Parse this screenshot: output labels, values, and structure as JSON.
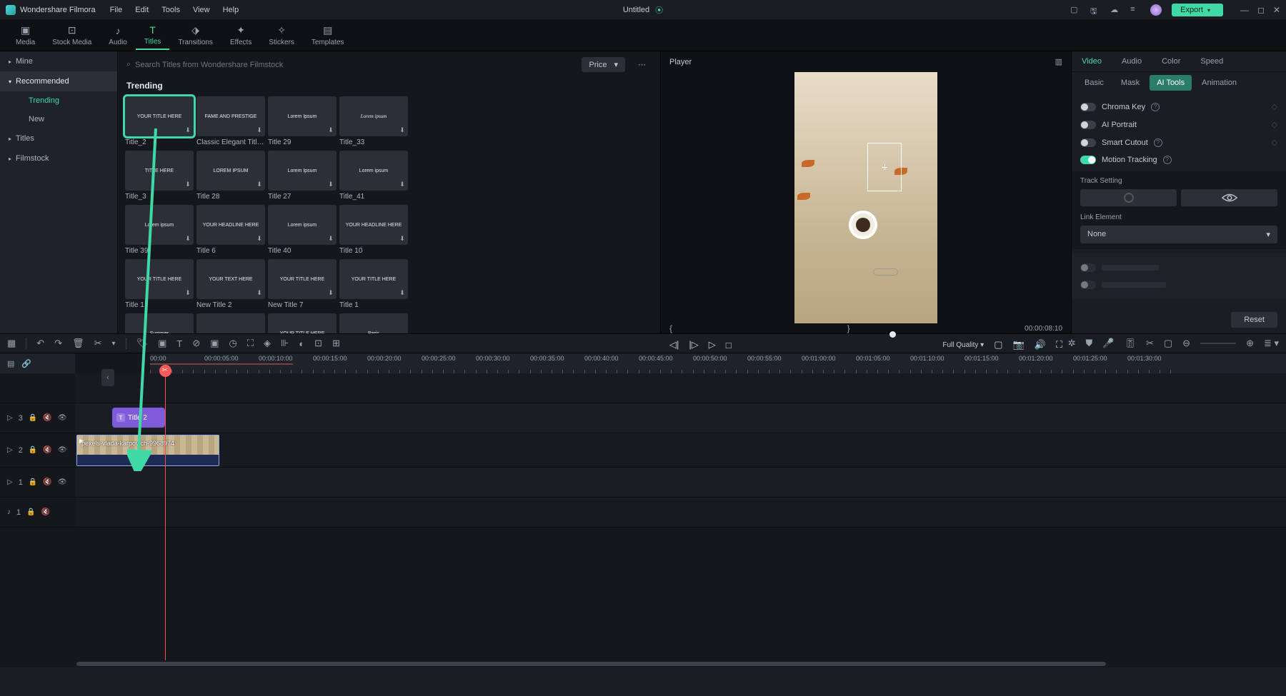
{
  "app": {
    "name": "Wondershare Filmora",
    "doc": "Untitled",
    "export": "Export"
  },
  "menus": [
    "File",
    "Edit",
    "Tools",
    "View",
    "Help"
  ],
  "tabs": [
    {
      "id": "media",
      "label": "Media"
    },
    {
      "id": "stock",
      "label": "Stock Media"
    },
    {
      "id": "audio",
      "label": "Audio"
    },
    {
      "id": "titles",
      "label": "Titles",
      "active": true
    },
    {
      "id": "transitions",
      "label": "Transitions"
    },
    {
      "id": "effects",
      "label": "Effects"
    },
    {
      "id": "stickers",
      "label": "Stickers"
    },
    {
      "id": "templates",
      "label": "Templates"
    }
  ],
  "tree": {
    "mine": "Mine",
    "recommended": "Recommended",
    "trending": "Trending",
    "new": "New",
    "titles": "Titles",
    "filmstock": "Filmstock"
  },
  "grid": {
    "search_ph": "Search Titles from Wondershare Filmstock",
    "sort": "Price",
    "section": "Trending",
    "cards": [
      {
        "label": "Title_2",
        "text": "YOUR TITLE HERE",
        "hl": true
      },
      {
        "label": "Classic Elegant Title P...",
        "text": "FAME AND PRESTIGE"
      },
      {
        "label": "Title 29",
        "text": "Lorem Ipsum"
      },
      {
        "label": "Title_33",
        "text": "Lorem ipsum",
        "italic": true
      },
      {
        "label": "Title_3",
        "text": "TITLE HERE"
      },
      {
        "label": "Title 28",
        "text": "LOREM IPSUM"
      },
      {
        "label": "Title 27",
        "text": "Lorem Ipsum"
      },
      {
        "label": "Title_41",
        "text": "Lorem ipsum"
      },
      {
        "label": "Title 39",
        "text": "Lorem ipsum"
      },
      {
        "label": "Title 6",
        "text": "YOUR HEADLINE HERE"
      },
      {
        "label": "Title 40",
        "text": "Lorem ipsum"
      },
      {
        "label": "Title 10",
        "text": "YOUR HEADLINE HERE"
      },
      {
        "label": "Title 1",
        "text": "YOUR TITLE HERE"
      },
      {
        "label": "New Title 2",
        "text": "YOUR TEXT HERE"
      },
      {
        "label": "New Title 7",
        "text": "YOUR TITLE HERE"
      },
      {
        "label": "Title 1",
        "text": "YOUR TITLE HERE"
      },
      {
        "label": "",
        "text": "Summer"
      },
      {
        "label": "",
        "text": ""
      },
      {
        "label": "",
        "text": "YOUR TITLE HERE"
      },
      {
        "label": "",
        "text": "Paris"
      }
    ]
  },
  "player": {
    "title": "Player",
    "tc": "00:00:08:10",
    "quality": "Full Quality"
  },
  "inspector": {
    "tabs": [
      "Video",
      "Audio",
      "Color",
      "Speed"
    ],
    "subtabs": [
      "Basic",
      "Mask",
      "AI Tools",
      "Animation"
    ],
    "props": {
      "chroma": "Chroma Key",
      "portrait": "AI Portrait",
      "cutout": "Smart Cutout",
      "tracking": "Motion Tracking",
      "track_setting": "Track Setting",
      "link_element": "Link Element",
      "link_value": "None",
      "reset": "Reset"
    }
  },
  "timeline": {
    "marks": [
      "00:00",
      "00:00:05:00",
      "00:00:10:00",
      "00:00:15:00",
      "00:00:20:00",
      "00:00:25:00",
      "00:00:30:00",
      "00:00:35:00",
      "00:00:40:00",
      "00:00:45:00",
      "00:00:50:00",
      "00:00:55:00",
      "00:01:00:00",
      "00:01:05:00",
      "00:01:10:00",
      "00:01:15:00",
      "00:01:20:00",
      "00:01:25:00",
      "00:01:30:00"
    ],
    "title_clip": "Title 2",
    "video_clip": "pexels-vlada-karpovich-9968974",
    "tracks": [
      {
        "type": "v",
        "n": "3"
      },
      {
        "type": "v",
        "n": "2"
      },
      {
        "type": "v",
        "n": "1"
      },
      {
        "type": "a",
        "n": "1"
      }
    ]
  }
}
